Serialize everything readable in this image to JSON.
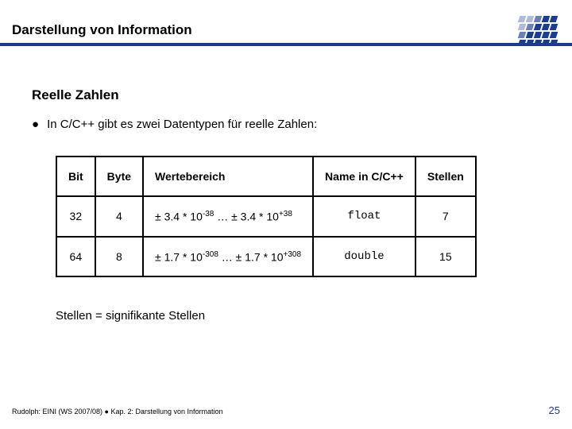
{
  "header": {
    "title": "Darstellung von Information"
  },
  "sub_heading": "Reelle Zahlen",
  "bullet": "In C/C++ gibt es zwei Datentypen für reelle Zahlen:",
  "table": {
    "headers": {
      "bit": "Bit",
      "byte": "Byte",
      "range": "Wertebereich",
      "name": "Name in C/C++",
      "digits": "Stellen"
    },
    "rows": [
      {
        "bit": "32",
        "byte": "4",
        "range_prefix": "± 3.4 * 10",
        "range_exp1": "-38",
        "range_mid": " … ± 3.4 * 10",
        "range_exp2": "+38",
        "name": "float",
        "digits": "7"
      },
      {
        "bit": "64",
        "byte": "8",
        "range_prefix": "± 1.7 * 10",
        "range_exp1": "-308",
        "range_mid": " … ± 1.7 * 10",
        "range_exp2": "+308",
        "name": "double",
        "digits": "15"
      }
    ]
  },
  "note": "Stellen = signifikante Stellen",
  "footer": {
    "left": "Rudolph: EINI (WS 2007/08)  ●  Kap. 2: Darstellung von Information",
    "page": "25"
  }
}
